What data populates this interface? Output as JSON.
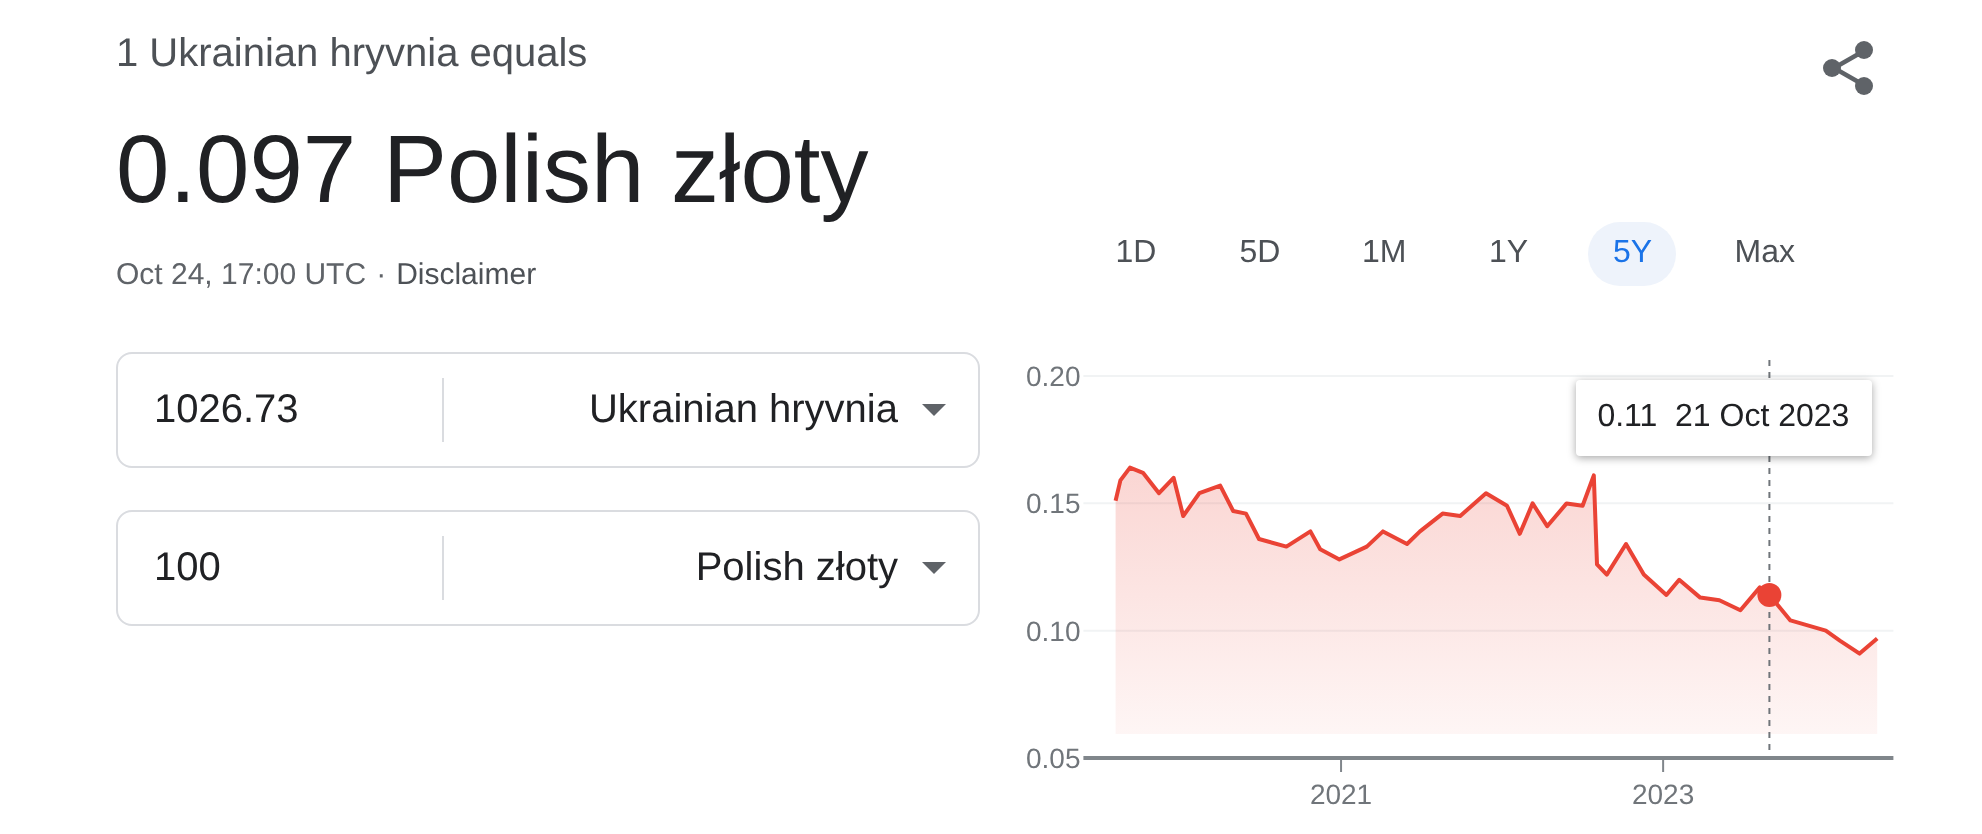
{
  "heading": "1 Ukrainian hryvnia equals",
  "result": "0.097 Polish złoty",
  "timestamp": "Oct 24, 17:00 UTC",
  "separator": "·",
  "disclaimer": "Disclaimer",
  "converters": [
    {
      "amount": "1026.73",
      "currency": "Ukrainian hryvnia"
    },
    {
      "amount": "100",
      "currency": "Polish złoty"
    }
  ],
  "ranges": [
    {
      "label": "1D",
      "selected": false
    },
    {
      "label": "5D",
      "selected": false
    },
    {
      "label": "1M",
      "selected": false
    },
    {
      "label": "1Y",
      "selected": false
    },
    {
      "label": "5Y",
      "selected": true
    },
    {
      "label": "Max",
      "selected": false
    }
  ],
  "chart": {
    "chart_data": {
      "type": "area",
      "xlim": [
        2019.4,
        2024.43
      ],
      "ylim": [
        0.05,
        0.2
      ],
      "xticks": [
        {
          "value": 2021,
          "label": "2021"
        },
        {
          "value": 2023,
          "label": "2023"
        }
      ],
      "yticks": [
        {
          "value": 0.05,
          "label": "0.05"
        },
        {
          "value": 0.1,
          "label": "0.10"
        },
        {
          "value": 0.15,
          "label": "0.15"
        },
        {
          "value": 0.2,
          "label": "0.20"
        }
      ],
      "x": [
        2019.6,
        2019.63,
        2019.69,
        2019.77,
        2019.87,
        2019.96,
        2020.02,
        2020.12,
        2020.25,
        2020.33,
        2020.41,
        2020.49,
        2020.66,
        2020.81,
        2020.87,
        2020.99,
        2021.16,
        2021.26,
        2021.41,
        2021.49,
        2021.63,
        2021.74,
        2021.9,
        2022.03,
        2022.11,
        2022.19,
        2022.28,
        2022.4,
        2022.5,
        2022.57,
        2022.59,
        2022.65,
        2022.77,
        2022.88,
        2023.02,
        2023.1,
        2023.23,
        2023.35,
        2023.48,
        2023.6,
        2023.66,
        2023.79,
        2024.01,
        2024.1,
        2024.22,
        2024.33
      ],
      "series": [
        {
          "color": "#ea4335",
          "values": [
            0.151,
            0.159,
            0.164,
            0.162,
            0.154,
            0.16,
            0.145,
            0.154,
            0.157,
            0.147,
            0.146,
            0.136,
            0.133,
            0.139,
            0.132,
            0.128,
            0.133,
            0.139,
            0.134,
            0.139,
            0.146,
            0.145,
            0.154,
            0.149,
            0.138,
            0.15,
            0.141,
            0.15,
            0.149,
            0.161,
            0.126,
            0.122,
            0.134,
            0.122,
            0.114,
            0.12,
            0.113,
            0.112,
            0.108,
            0.117,
            0.114,
            0.104,
            0.1,
            0.096,
            0.091,
            0.097
          ]
        }
      ],
      "ref_lines": [
        {
          "axis": "x",
          "value": 2023.66
        }
      ],
      "annotations": [
        "0.11  21 Oct 2023"
      ]
    }
  }
}
